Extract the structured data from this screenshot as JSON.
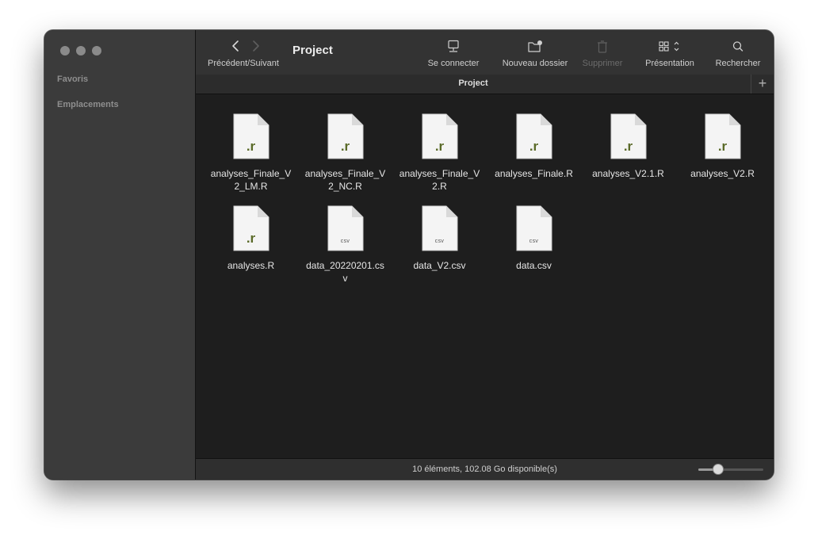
{
  "window": {
    "title": "Project"
  },
  "sidebar": {
    "sections": [
      {
        "label": "Favoris"
      },
      {
        "label": "Emplacements"
      }
    ]
  },
  "toolbar": {
    "nav_label": "Précédent/Suivant",
    "back_icon": "chevron-left-icon",
    "forward_icon": "chevron-right-icon",
    "tools": [
      {
        "label": "Se connecter",
        "icon": "connect-server-icon",
        "enabled": true
      },
      {
        "label": "Nouveau dossier",
        "icon": "new-folder-icon",
        "enabled": true
      },
      {
        "label": "Supprimer",
        "icon": "trash-icon",
        "enabled": false
      },
      {
        "label": "Présentation",
        "icon": "grid-view-icon",
        "enabled": true
      },
      {
        "label": "Rechercher",
        "icon": "search-icon",
        "enabled": true
      }
    ]
  },
  "tabs": [
    {
      "label": "Project"
    }
  ],
  "files": [
    {
      "name": "analyses_Finale_V2_LM.R",
      "badge": ".r",
      "kind": "r"
    },
    {
      "name": "analyses_Finale_V2_NC.R",
      "badge": ".r",
      "kind": "r"
    },
    {
      "name": "analyses_Finale_V2.R",
      "badge": ".r",
      "kind": "r"
    },
    {
      "name": "analyses_Finale.R",
      "badge": ".r",
      "kind": "r"
    },
    {
      "name": "analyses_V2.1.R",
      "badge": ".r",
      "kind": "r"
    },
    {
      "name": "analyses_V2.R",
      "badge": ".r",
      "kind": "r"
    },
    {
      "name": "analyses.R",
      "badge": ".r",
      "kind": "r"
    },
    {
      "name": "data_20220201.csv",
      "badge": "csv",
      "kind": "csv"
    },
    {
      "name": "data_V2.csv",
      "badge": "csv",
      "kind": "csv"
    },
    {
      "name": "data.csv",
      "badge": "csv",
      "kind": "csv"
    }
  ],
  "status": {
    "text": "10 éléments, 102.08 Go disponible(s)",
    "zoom_level": 0.27
  },
  "colors": {
    "r_badge": "#5a6a28",
    "window_bg": "#1e1e1e",
    "sidebar_bg": "#3b3b3b"
  }
}
